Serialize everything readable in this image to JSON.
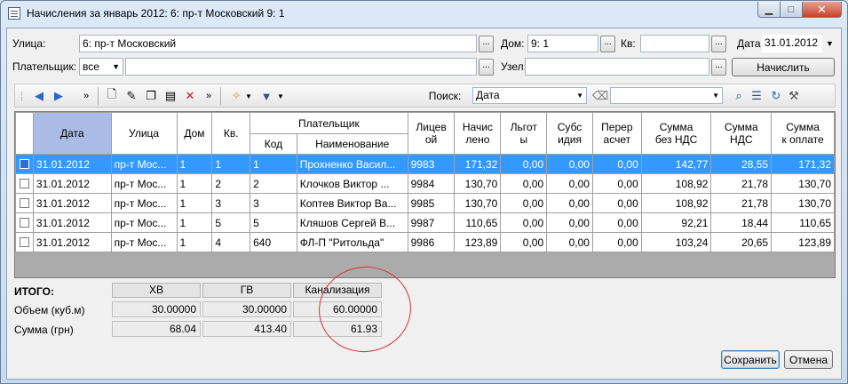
{
  "window": {
    "title": "Начисления за январь 2012: 6: пр-т Московский 9: 1",
    "min": "▁",
    "max": "□",
    "close": "✕"
  },
  "form": {
    "street_label": "Улица:",
    "street_value": "6: пр-т Московский",
    "house_label": "Дом:",
    "house_value": "9: 1",
    "apt_label": "Кв:",
    "apt_value": "",
    "date_label": "Дата",
    "date_value": "31.01.2012",
    "payer_label": "Плательщик:",
    "payer_select": "все",
    "payer_value": "",
    "node_label": "Узел:",
    "node_value": "",
    "calc_button": "Начислить",
    "dots": "..."
  },
  "toolbar": {
    "search_label": "Поиск:",
    "search_field": "Дата",
    "search_value": "",
    "more": "»"
  },
  "table": {
    "headers": {
      "date": "Дата",
      "street": "Улица",
      "house": "Дом",
      "apt": "Кв.",
      "payer": "Плательщик",
      "code": "Код",
      "name": "Наименование",
      "account": [
        "Лицев",
        "ой"
      ],
      "charged": [
        "Начис",
        "лено"
      ],
      "benefit": [
        "Льгот",
        "ы"
      ],
      "subsidy": [
        "Субс",
        "идия"
      ],
      "recalc": [
        "Перер",
        "асчет"
      ],
      "sum_novat": [
        "Сумма",
        "без НДС"
      ],
      "vat": [
        "Сумма",
        "НДС"
      ],
      "total": [
        "Сумма",
        "к оплате"
      ]
    },
    "rows": [
      {
        "date": "31.01.2012",
        "street": "пр-т Мос...",
        "house": "1",
        "apt": "1",
        "code": "1",
        "name": "Прохненко Васил...",
        "account": "9983",
        "charged": "171,32",
        "benefit": "0,00",
        "subsidy": "0,00",
        "recalc": "0,00",
        "sum_novat": "142,77",
        "vat": "28,55",
        "total": "171,32"
      },
      {
        "date": "31.01.2012",
        "street": "пр-т Мос...",
        "house": "1",
        "apt": "2",
        "code": "2",
        "name": "Клочков Виктор ...",
        "account": "9984",
        "charged": "130,70",
        "benefit": "0,00",
        "subsidy": "0,00",
        "recalc": "0,00",
        "sum_novat": "108,92",
        "vat": "21,78",
        "total": "130,70"
      },
      {
        "date": "31.01.2012",
        "street": "пр-т Мос...",
        "house": "1",
        "apt": "3",
        "code": "3",
        "name": "Коптев Виктор Ва...",
        "account": "9985",
        "charged": "130,70",
        "benefit": "0,00",
        "subsidy": "0,00",
        "recalc": "0,00",
        "sum_novat": "108,92",
        "vat": "21,78",
        "total": "130,70"
      },
      {
        "date": "31.01.2012",
        "street": "пр-т Мос...",
        "house": "1",
        "apt": "5",
        "code": "5",
        "name": "Кляшов Сергей В...",
        "account": "9987",
        "charged": "110,65",
        "benefit": "0,00",
        "subsidy": "0,00",
        "recalc": "0,00",
        "sum_novat": "92,21",
        "vat": "18,44",
        "total": "110,65"
      },
      {
        "date": "31.01.2012",
        "street": "пр-т Мос...",
        "house": "1",
        "apt": "4",
        "code": "640",
        "name": "ФЛ-П \"Ритольда\"",
        "account": "9986",
        "charged": "123,89",
        "benefit": "0,00",
        "subsidy": "0,00",
        "recalc": "0,00",
        "sum_novat": "103,24",
        "vat": "20,65",
        "total": "123,89"
      }
    ]
  },
  "totals": {
    "title": "ИТОГО:",
    "col_hv": "ХВ",
    "col_gv": "ГВ",
    "col_kan": "Канализация",
    "row_volume": "Объем (куб.м)",
    "row_sum": "Сумма (грн)",
    "volume_hv": "30.00000",
    "volume_gv": "30.00000",
    "volume_kan": "60.00000",
    "sum_hv": "68.04",
    "sum_gv": "413.40",
    "sum_kan": "61.93"
  },
  "footer": {
    "save": "Сохранить",
    "cancel": "Отмена"
  }
}
